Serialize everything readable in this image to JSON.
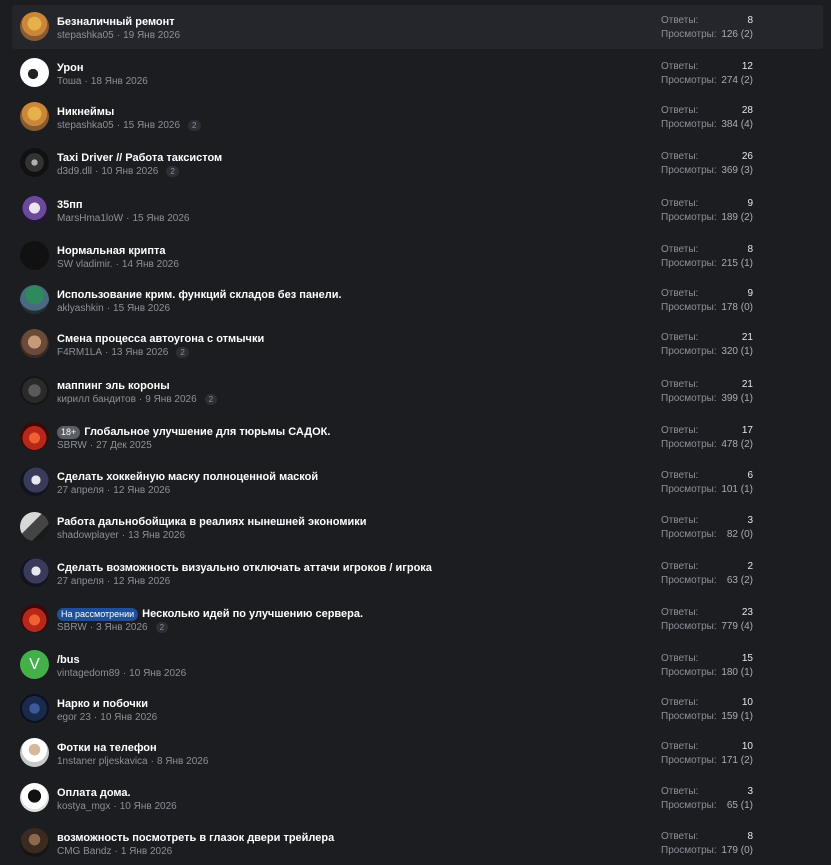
{
  "labels": {
    "replies": "Ответы:",
    "views": "Просмотры:"
  },
  "threads": [
    {
      "title": "Безналичный ремонт",
      "prefix": null,
      "prefix_type": null,
      "author": "stepashka05",
      "date": "19 Янв 2026",
      "pages": null,
      "replies": "8",
      "views": "126 (2)",
      "avatar": "avatar-stepashka",
      "highlighted": true
    },
    {
      "title": "Урон",
      "prefix": null,
      "prefix_type": null,
      "author": "Тоша",
      "date": "18 Янв 2026",
      "pages": null,
      "replies": "12",
      "views": "274 (2)",
      "avatar": "avatar-tosha",
      "highlighted": false
    },
    {
      "title": "Никнеймы",
      "prefix": null,
      "prefix_type": null,
      "author": "stepashka05",
      "date": "15 Янв 2026",
      "pages": "2",
      "replies": "28",
      "views": "384 (4)",
      "avatar": "avatar-stepashka",
      "highlighted": false
    },
    {
      "title": "Taxi Driver // Работа таксистом",
      "prefix": null,
      "prefix_type": null,
      "author": "d3d9.dll",
      "date": "10 Янв 2026",
      "pages": "2",
      "replies": "26",
      "views": "369 (3)",
      "avatar": "avatar-d3d9",
      "highlighted": false
    },
    {
      "title": "35пп",
      "prefix": null,
      "prefix_type": null,
      "author": "MarsHma1loW",
      "date": "15 Янв 2026",
      "pages": null,
      "replies": "9",
      "views": "189 (2)",
      "avatar": "avatar-mars",
      "highlighted": false
    },
    {
      "title": "Нормальная крипта",
      "prefix": null,
      "prefix_type": null,
      "author": "SW vladimir.",
      "date": "14 Янв 2026",
      "pages": null,
      "replies": "8",
      "views": "215 (1)",
      "avatar": "avatar-sw",
      "highlighted": false
    },
    {
      "title": "Использование крим. функций складов без панели.",
      "prefix": null,
      "prefix_type": null,
      "author": "aklyashkin",
      "date": "15 Янв 2026",
      "pages": null,
      "replies": "9",
      "views": "178 (0)",
      "avatar": "avatar-aklyashkin",
      "highlighted": false
    },
    {
      "title": "Смена процесса автоугона с отмычки",
      "prefix": null,
      "prefix_type": null,
      "author": "F4RM1LA",
      "date": "13 Янв 2026",
      "pages": "2",
      "replies": "21",
      "views": "320 (1)",
      "avatar": "avatar-f4rm1la",
      "highlighted": false
    },
    {
      "title": "маппинг эль короны",
      "prefix": null,
      "prefix_type": null,
      "author": "кирилл бандитов",
      "date": "9 Янв 2026",
      "pages": "2",
      "replies": "21",
      "views": "399 (1)",
      "avatar": "avatar-kirill",
      "highlighted": false
    },
    {
      "title": "Глобальное улучшение для тюрьмы САДОК.",
      "prefix": "18+",
      "prefix_type": "age",
      "author": "SBRW",
      "date": "27 Дек 2025",
      "pages": null,
      "replies": "17",
      "views": "478 (2)",
      "avatar": "avatar-sbrw",
      "highlighted": false
    },
    {
      "title": "Сделать хоккейную маску полноценной маской",
      "prefix": null,
      "prefix_type": null,
      "author": "27 апреля",
      "date": "12 Янв 2026",
      "pages": null,
      "replies": "6",
      "views": "101 (1)",
      "avatar": "avatar-27apr",
      "highlighted": false
    },
    {
      "title": "Работа дальнобойщика в реалиях нынешней экономики",
      "prefix": null,
      "prefix_type": null,
      "author": "shadowplayer",
      "date": "13 Янв 2026",
      "pages": null,
      "replies": "3",
      "views": "82 (0)",
      "avatar": "avatar-shadow",
      "highlighted": false
    },
    {
      "title": "Сделать возможность визуально отключать аттачи игроков / игрока",
      "prefix": null,
      "prefix_type": null,
      "author": "27 апреля",
      "date": "12 Янв 2026",
      "pages": null,
      "replies": "2",
      "views": "63 (2)",
      "avatar": "avatar-27apr",
      "highlighted": false
    },
    {
      "title": "Несколько идей по улучшению сервера.",
      "prefix": "На рассмотрении",
      "prefix_type": "review",
      "author": "SBRW",
      "date": "3 Янв 2026",
      "pages": "2",
      "replies": "23",
      "views": "779 (4)",
      "avatar": "avatar-sbrw",
      "highlighted": false
    },
    {
      "title": "/bus",
      "prefix": null,
      "prefix_type": null,
      "author": "vintagedom89",
      "date": "10 Янв 2026",
      "pages": null,
      "replies": "15",
      "views": "180 (1)",
      "avatar": "avatar-letter-v",
      "avatar_letter": "V",
      "highlighted": false
    },
    {
      "title": "Нарко и побочки",
      "prefix": null,
      "prefix_type": null,
      "author": "egor 23",
      "date": "10 Янв 2026",
      "pages": null,
      "replies": "10",
      "views": "159 (1)",
      "avatar": "avatar-egor",
      "highlighted": false
    },
    {
      "title": "Фотки на телефон",
      "prefix": null,
      "prefix_type": null,
      "author": "1nstaner pljeskavica",
      "date": "8 Янв 2026",
      "pages": null,
      "replies": "10",
      "views": "171 (2)",
      "avatar": "avatar-1nstaner",
      "highlighted": false
    },
    {
      "title": "Оплата дома.",
      "prefix": null,
      "prefix_type": null,
      "author": "kostya_mgx",
      "date": "10 Янв 2026",
      "pages": null,
      "replies": "3",
      "views": "65 (1)",
      "avatar": "avatar-kostya",
      "highlighted": false
    },
    {
      "title": "возможность посмотреть в глазок двери трейлера",
      "prefix": null,
      "prefix_type": null,
      "author": "CMG Bandz",
      "date": "1 Янв 2026",
      "pages": null,
      "replies": "8",
      "views": "179 (0)",
      "avatar": "avatar-cmg",
      "highlighted": false
    }
  ]
}
